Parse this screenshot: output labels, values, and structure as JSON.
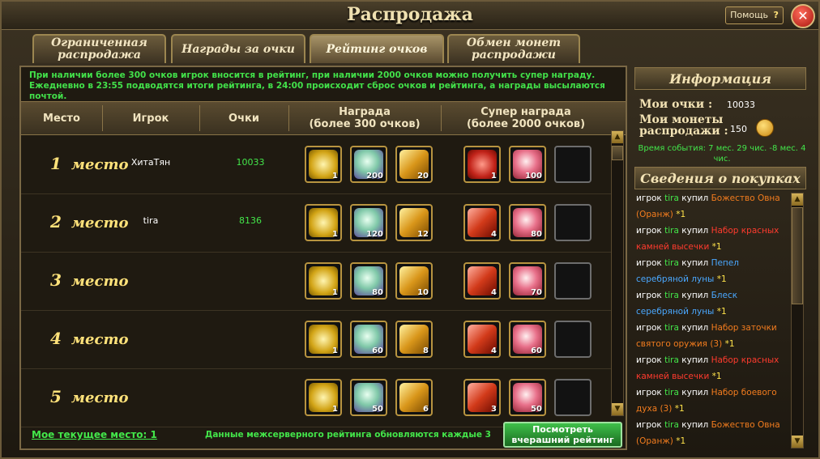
{
  "window": {
    "title": "Распродажа",
    "help_label": "Помощь",
    "help_glyph": "?",
    "close_glyph": "✕"
  },
  "tabs": [
    {
      "label": "Ограниченная распродажа"
    },
    {
      "label": "Награды за очки"
    },
    {
      "label": "Рейтинг очков",
      "active": true
    },
    {
      "label": "Обмен монет распродажи"
    }
  ],
  "notice": "При наличии более 300 очков игрок вносится в рейтинг, при наличии 2000 очков можно получить супер награду. Ежедневно в 23:55 подводятся итоги рейтинга, в 24:00 происходит сброс очков и рейтинга, а награды высылаются почтой.",
  "table": {
    "headers": {
      "place": "Место",
      "player": "Игрок",
      "points": "Очки",
      "reward": "Награда\n(более 300 очков)",
      "super": "Супер награда\n(более 2000 очков)"
    },
    "place_word": "место",
    "rows": [
      {
        "n": "1",
        "player": "ХитаТян",
        "points": "10033",
        "rewards": [
          "1",
          "200",
          "20"
        ],
        "super": [
          "1",
          "100",
          ""
        ]
      },
      {
        "n": "2",
        "player": "tira",
        "points": "8136",
        "rewards": [
          "1",
          "120",
          "12"
        ],
        "super": [
          "4",
          "80",
          ""
        ]
      },
      {
        "n": "3",
        "player": "",
        "points": "",
        "rewards": [
          "1",
          "80",
          "10"
        ],
        "super": [
          "4",
          "70",
          ""
        ]
      },
      {
        "n": "4",
        "player": "",
        "points": "",
        "rewards": [
          "1",
          "60",
          "8"
        ],
        "super": [
          "4",
          "60",
          ""
        ]
      },
      {
        "n": "5",
        "player": "",
        "points": "",
        "rewards": [
          "1",
          "50",
          "6"
        ],
        "super": [
          "3",
          "50",
          ""
        ]
      }
    ]
  },
  "footer": {
    "my_place": "Мое текущее место: 1",
    "server_note": "Данные межсерверного рейтинга обновляются каждые 3",
    "yesterday_button": "Посмотреть вчерашний рейтинг"
  },
  "info": {
    "header": "Информация",
    "my_points_label": "Мои очки :",
    "my_points": "10033",
    "my_coins_label": "Мои монеты распродажи :",
    "my_coins": "150",
    "event_time": "Время события: 7 мес. 29 чис. -8 мес. 4 чис."
  },
  "purchases": {
    "header": "Сведения о покупках",
    "entries": [
      {
        "prefix": "игрок",
        "who": "tira",
        "verb": "купил",
        "item": "Божество Овна (Оранж)",
        "color": "orange",
        "count": "*1"
      },
      {
        "prefix": "игрок",
        "who": "tira",
        "verb": "купил",
        "item": "Набор красных камней высечки",
        "color": "red",
        "count": "*1"
      },
      {
        "prefix": "игрок",
        "who": "tira",
        "verb": "купил",
        "item": "Пепел серебряной луны",
        "color": "blue",
        "count": "*1"
      },
      {
        "prefix": "игрок",
        "who": "tira",
        "verb": "купил",
        "item": "Блеск серебряной луны",
        "color": "blue",
        "count": "*1"
      },
      {
        "prefix": "игрок",
        "who": "tira",
        "verb": "купил",
        "item": "Набор заточки святого оружия (3)",
        "color": "orange",
        "count": "*1"
      },
      {
        "prefix": "игрок",
        "who": "tira",
        "verb": "купил",
        "item": "Набор красных камней высечки",
        "color": "red",
        "count": "*1"
      },
      {
        "prefix": "игрок",
        "who": "tira",
        "verb": "купил",
        "item": "Набор боевого духа (3)",
        "color": "orange",
        "count": "*1"
      },
      {
        "prefix": "игрок",
        "who": "tira",
        "verb": "купил",
        "item": "Божество Овна (Оранж)",
        "color": "orange",
        "count": "*1"
      }
    ]
  },
  "scroll": {
    "up": "▲",
    "down": "▼"
  }
}
